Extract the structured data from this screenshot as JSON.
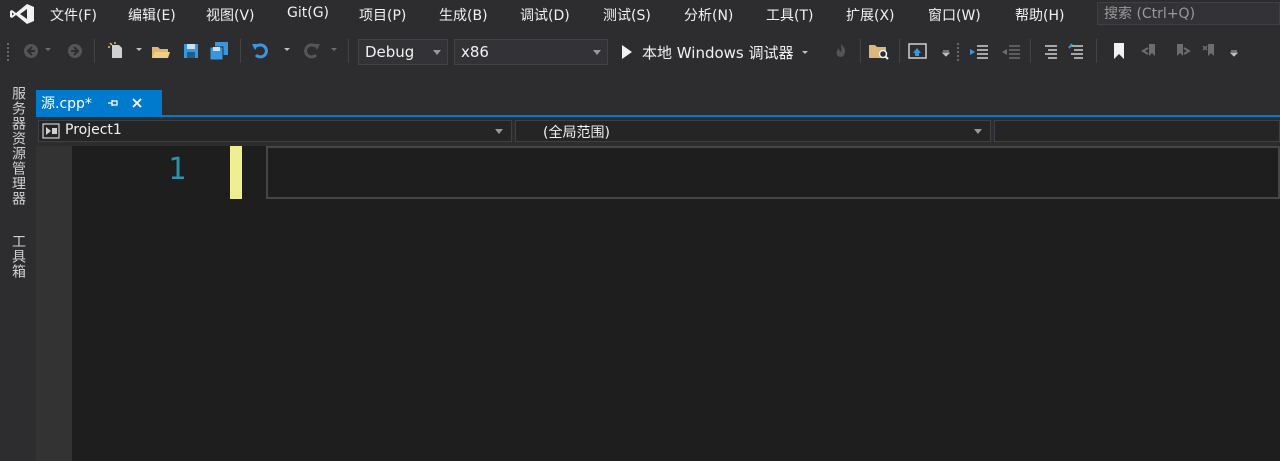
{
  "menu": {
    "items": [
      {
        "key": "file",
        "label": "文件(F)"
      },
      {
        "key": "edit",
        "label": "编辑(E)"
      },
      {
        "key": "view",
        "label": "视图(V)"
      },
      {
        "key": "git",
        "label": "Git(G)"
      },
      {
        "key": "project",
        "label": "项目(P)"
      },
      {
        "key": "build",
        "label": "生成(B)"
      },
      {
        "key": "debug",
        "label": "调试(D)"
      },
      {
        "key": "test",
        "label": "测试(S)"
      },
      {
        "key": "analyze",
        "label": "分析(N)"
      },
      {
        "key": "tools",
        "label": "工具(T)"
      },
      {
        "key": "extensions",
        "label": "扩展(X)"
      },
      {
        "key": "window",
        "label": "窗口(W)"
      },
      {
        "key": "help",
        "label": "帮助(H)"
      }
    ],
    "search_placeholder": "搜索 (Ctrl+Q)"
  },
  "toolbar": {
    "configuration": "Debug",
    "platform": "x86",
    "start_debugger_label": "本地 Windows 调试器",
    "icons": [
      "back-icon",
      "forward-icon",
      "new-item-icon",
      "open-folder-icon",
      "save-icon",
      "save-all-icon",
      "undo-icon",
      "redo-icon",
      "start-icon",
      "hot-reload-icon",
      "find-in-files-icon",
      "solution-explorer-icon",
      "indent-icon",
      "outdent-icon",
      "comment-icon",
      "uncomment-icon",
      "bookmark-icon",
      "prev-bookmark-icon",
      "next-bookmark-icon",
      "clear-bookmarks-icon"
    ]
  },
  "side_tabs": {
    "server_explorer": "服务器资源管理器",
    "toolbox": "工具箱"
  },
  "editor": {
    "tab_title": "源.cpp*",
    "project_scope": "Project1",
    "global_scope": "(全局范围)",
    "line_numbers": [
      "1"
    ]
  },
  "colors": {
    "accent": "#007acc",
    "background": "#2d2d30",
    "editor_bg": "#1e1e1e",
    "line_number": "#2b91af",
    "change_marker": "#efef91"
  }
}
